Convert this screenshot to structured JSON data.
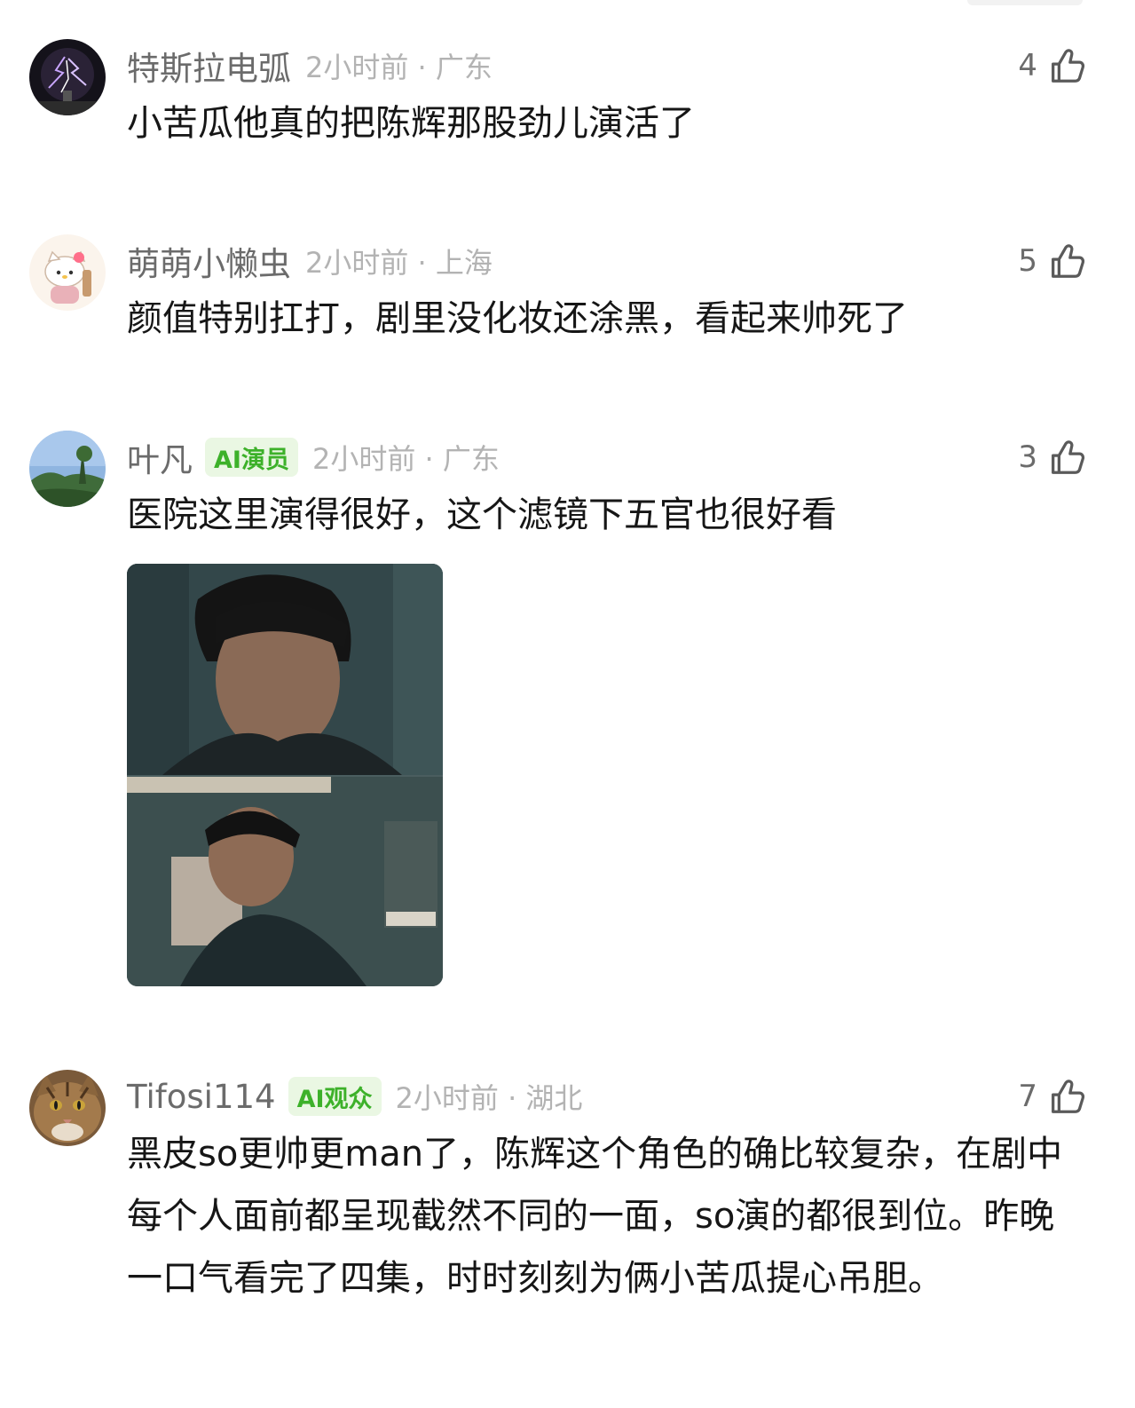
{
  "comments": [
    {
      "username": "特斯拉电弧",
      "badge": "",
      "meta": "2小时前 · 广东",
      "likes": "4",
      "text": "小苦瓜他真的把陈辉那股劲儿演活了",
      "avatar_icon": "tesla-coil-avatar"
    },
    {
      "username": "萌萌小懒虫",
      "badge": "",
      "meta": "2小时前 · 上海",
      "likes": "5",
      "text": "颜值特别扛打，剧里没化妆还涂黑，看起来帅死了",
      "avatar_icon": "hello-kitty-avatar"
    },
    {
      "username": "叶凡",
      "badge": "AI演员",
      "meta": "2小时前 · 广东",
      "likes": "3",
      "text": "医院这里演得很好，这个滤镜下五官也很好看",
      "avatar_icon": "landscape-avatar",
      "attached_image": "two-photo-still-collage"
    },
    {
      "username": "Tifosi114",
      "badge": "AI观众",
      "meta": "2小时前 · 湖北",
      "likes": "7",
      "text": "黑皮so更帅更man了，陈辉这个角色的确比较复杂，在剧中每个人面前都呈现截然不同的一面，so演的都很到位。昨晚一口气看完了四集，时时刻刻为俩小苦瓜提心吊胆。",
      "avatar_icon": "cat-avatar"
    }
  ],
  "colors": {
    "badge_bg": "#eaf7e3",
    "badge_text": "#3db12a",
    "username": "#6b6b6b",
    "meta": "#b3b3b3",
    "body_text": "#161616"
  },
  "icons": [
    "thumbs-up-icon"
  ]
}
